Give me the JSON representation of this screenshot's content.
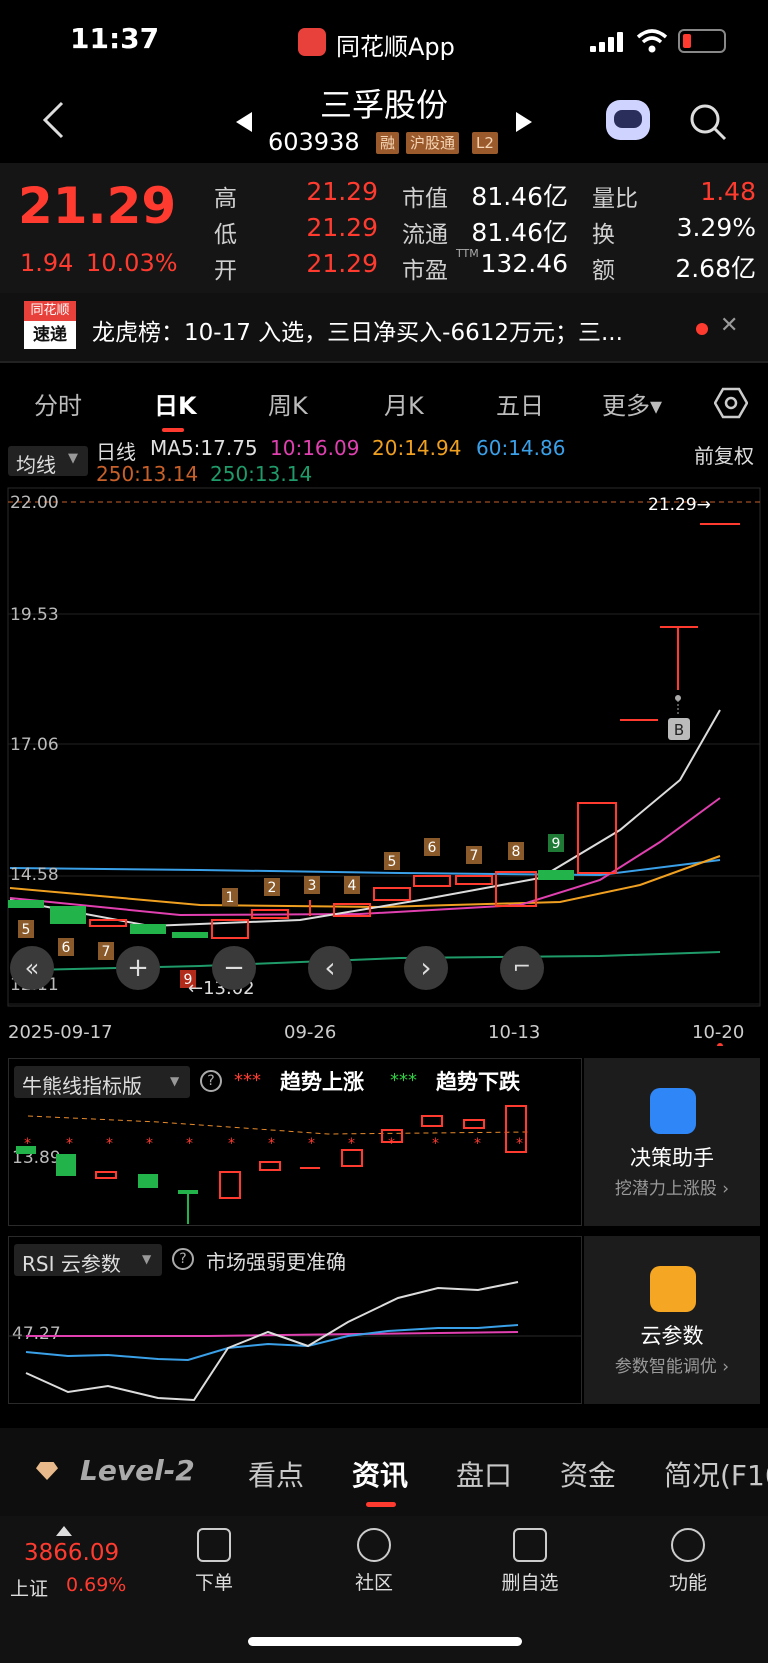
{
  "status": {
    "time": "11:37",
    "app": "同花顺App"
  },
  "header": {
    "name": "三孚股份",
    "code": "603938",
    "tags": [
      "融",
      "沪股通",
      "L2"
    ]
  },
  "quote": {
    "price": "21.29",
    "change": "1.94",
    "pct": "10.03%",
    "high_label": "高",
    "high": "21.29",
    "low_label": "低",
    "low": "21.29",
    "open_label": "开",
    "open": "21.29",
    "mcap_label": "市值",
    "mcap": "81.46亿",
    "float_label": "流通",
    "float": "81.46亿",
    "pe_label": "市盈",
    "pe_sup": "TTM",
    "pe": "132.46",
    "vr_label": "量比",
    "vr": "1.48",
    "turn_label": "换",
    "turn": "3.29%",
    "amt_label": "额",
    "amt": "2.68亿"
  },
  "news": {
    "logo_top": "同花顺",
    "logo_bottom": "速递",
    "text": "龙虎榜：10-17 入选，三日净买入-6612万元；三...",
    "close": "✕"
  },
  "tabs": [
    "分时",
    "日K",
    "周K",
    "月K",
    "五日",
    "更多▾"
  ],
  "active_tab": "日K",
  "ma": {
    "dropdown": "均线",
    "label": "日线",
    "ma5": "MA5:17.75",
    "ma10": "10:16.09",
    "ma20": "20:14.94",
    "ma60": "60:14.86",
    "ma250a": "250:13.14",
    "ma250b": "250:13.14",
    "adjust": "前复权"
  },
  "chart_data": {
    "type": "candlestick",
    "y_ticks": [
      "22.00",
      "19.53",
      "17.06",
      "14.58",
      "12.11"
    ],
    "x_labels": [
      "2025-09-17",
      "09-26",
      "10-13",
      "10-20"
    ],
    "last_price_label": "21.29→",
    "low_marker": "←13.02",
    "buy_marker": "B",
    "seq_markers": [
      "5",
      "6",
      "7",
      "8",
      "9",
      "1",
      "2",
      "3",
      "4",
      "5",
      "6",
      "7",
      "8",
      "9"
    ],
    "colors": {
      "up": "#ff3b30",
      "down": "#22b34a",
      "ma5": "#e0e0e0",
      "ma10": "#e040b0",
      "ma20": "#f0a020",
      "ma60": "#3aa0e8",
      "ma250": "#1f9b6a"
    }
  },
  "controls": [
    "«",
    "+",
    "−",
    "‹",
    "›",
    "⌐"
  ],
  "sub1": {
    "dropdown": "牛熊线指标版",
    "up_mark": "***",
    "up_text": "趋势上涨",
    "down_mark": "***",
    "down_text": "趋势下跌",
    "y_label": "13.89",
    "card_title": "决策助手",
    "card_sub": "挖潜力上涨股 ›"
  },
  "sub2": {
    "dropdown": "RSI 云参数",
    "note": "市场强弱更准确",
    "y_label": "47.27",
    "card_title": "云参数",
    "card_sub": "参数智能调优 ›"
  },
  "bottom_tabs": [
    "Level-2",
    "看点",
    "资讯",
    "盘口",
    "资金",
    "简况(F10"
  ],
  "active_bottom_tab": "资讯",
  "index": {
    "value": "3866.09",
    "name": "上证",
    "pct": "0.69%"
  },
  "dock": [
    "下单",
    "社区",
    "删自选",
    "功能"
  ]
}
